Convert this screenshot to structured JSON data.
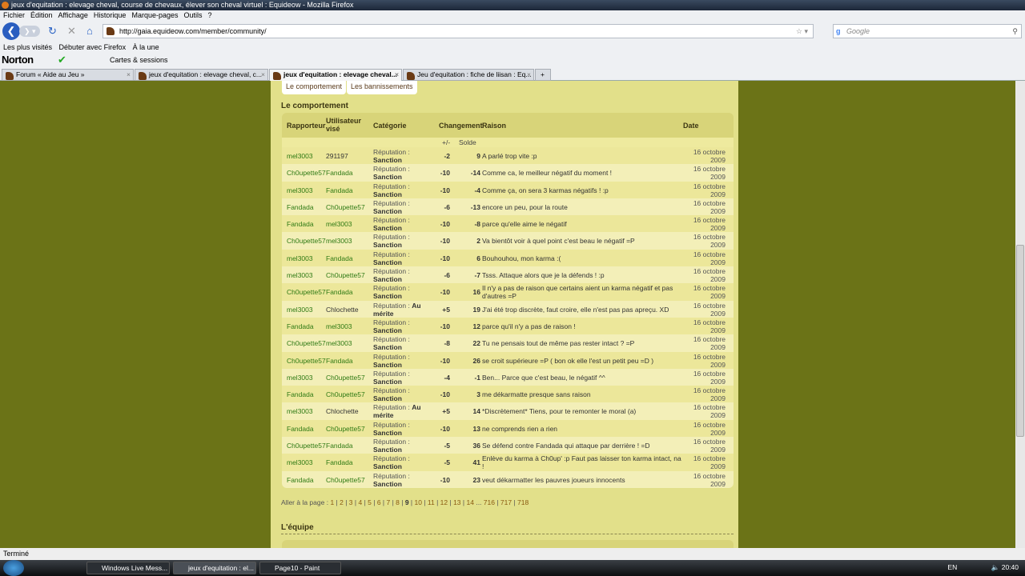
{
  "window": {
    "title": "jeux d'equitation : elevage cheval, course de chevaux, élever son cheval virtuel : Equideow - Mozilla Firefox"
  },
  "menu": [
    "Fichier",
    "Édition",
    "Affichage",
    "Historique",
    "Marque-pages",
    "Outils",
    "?"
  ],
  "url": "http://gaia.equideow.com/member/community/",
  "search_placeholder": "Google",
  "bookmarks": [
    "Les plus visités",
    "Débuter avec Firefox",
    "À la une"
  ],
  "norton": {
    "brand": "Norton",
    "cards": "Cartes & sessions"
  },
  "tabs": [
    "Forum « Aide au Jeu »",
    "jeux d'equitation : elevage cheval, c...",
    "jeux d'equitation : elevage cheval...",
    "Jeu d'equitation : fiche de liisan : Eq..."
  ],
  "subtabs": [
    "Le comportement",
    "Les bannissements"
  ],
  "section_title": "Le comportement",
  "headers": {
    "rep": "Rapporteur",
    "tgt": "Utilisateur visé",
    "cat": "Catégorie",
    "chg": "Changement",
    "rea": "Raison",
    "date": "Date",
    "pm": "+/-",
    "sol": "Solde"
  },
  "cat_prefix": "Réputation :",
  "rows": [
    {
      "rep": "mel3003",
      "tgt": "291197",
      "tl": false,
      "cat": "Sanction",
      "pm": "-2",
      "sol": "9",
      "rea": "A parlé trop vite :p",
      "date": "16 octobre 2009"
    },
    {
      "rep": "Ch0upette57",
      "tgt": "Fandada",
      "tl": true,
      "cat": "Sanction",
      "pm": "-10",
      "sol": "-14",
      "rea": "Comme ca, le meilleur négatif du moment !",
      "date": "16 octobre 2009"
    },
    {
      "rep": "mel3003",
      "tgt": "Fandada",
      "tl": true,
      "cat": "Sanction",
      "pm": "-10",
      "sol": "-4",
      "rea": "Comme ça, on sera 3 karmas négatifs ! :p",
      "date": "16 octobre 2009"
    },
    {
      "rep": "Fandada",
      "tgt": "Ch0upette57",
      "tl": true,
      "cat": "Sanction",
      "pm": "-6",
      "sol": "-13",
      "rea": "encore un peu, pour la route",
      "date": "16 octobre 2009"
    },
    {
      "rep": "Fandada",
      "tgt": "mel3003",
      "tl": true,
      "cat": "Sanction",
      "pm": "-10",
      "sol": "-8",
      "rea": "parce qu'elle aime le négatif",
      "date": "16 octobre 2009"
    },
    {
      "rep": "Ch0upette57",
      "tgt": "mel3003",
      "tl": true,
      "cat": "Sanction",
      "pm": "-10",
      "sol": "2",
      "rea": "Va bientôt voir à quel point c'est beau le négatif =P",
      "date": "16 octobre 2009"
    },
    {
      "rep": "mel3003",
      "tgt": "Fandada",
      "tl": true,
      "cat": "Sanction",
      "pm": "-10",
      "sol": "6",
      "rea": "Bouhouhou, mon karma :(",
      "date": "16 octobre 2009"
    },
    {
      "rep": "mel3003",
      "tgt": "Ch0upette57",
      "tl": true,
      "cat": "Sanction",
      "pm": "-6",
      "sol": "-7",
      "rea": "Tsss. Attaque alors que je la défends ! :p",
      "date": "16 octobre 2009"
    },
    {
      "rep": "Ch0upette57",
      "tgt": "Fandada",
      "tl": true,
      "cat": "Sanction",
      "pm": "-10",
      "sol": "16",
      "rea": "Il n'y a pas de raison que certains aient un karma négatif et pas d'autres =P",
      "date": "16 octobre 2009"
    },
    {
      "rep": "mel3003",
      "tgt": "Chlochette",
      "tl": false,
      "cat": "Au mérite",
      "pm": "+5",
      "sol": "19",
      "rea": "J'ai été trop discrète, faut croire, elle n'est pas pas apreçu. XD",
      "date": "16 octobre 2009"
    },
    {
      "rep": "Fandada",
      "tgt": "mel3003",
      "tl": true,
      "cat": "Sanction",
      "pm": "-10",
      "sol": "12",
      "rea": "parce qu'il n'y a pas de raison !",
      "date": "16 octobre 2009"
    },
    {
      "rep": "Ch0upette57",
      "tgt": "mel3003",
      "tl": true,
      "cat": "Sanction",
      "pm": "-8",
      "sol": "22",
      "rea": "Tu ne pensais tout de même pas rester intact ? =P",
      "date": "16 octobre 2009"
    },
    {
      "rep": "Ch0upette57",
      "tgt": "Fandada",
      "tl": true,
      "cat": "Sanction",
      "pm": "-10",
      "sol": "26",
      "rea": "se croit supérieure =P ( bon ok elle l'est un petit peu =D )",
      "date": "16 octobre 2009"
    },
    {
      "rep": "mel3003",
      "tgt": "Ch0upette57",
      "tl": true,
      "cat": "Sanction",
      "pm": "-4",
      "sol": "-1",
      "rea": "Ben... Parce que c'est beau, le négatif ^^",
      "date": "16 octobre 2009"
    },
    {
      "rep": "Fandada",
      "tgt": "Ch0upette57",
      "tl": true,
      "cat": "Sanction",
      "pm": "-10",
      "sol": "3",
      "rea": "me dékarmatte presque sans raison",
      "date": "16 octobre 2009"
    },
    {
      "rep": "mel3003",
      "tgt": "Chlochette",
      "tl": false,
      "cat": "Au mérite",
      "pm": "+5",
      "sol": "14",
      "rea": "*Discrètement* Tiens, pour te remonter le moral (a)",
      "date": "16 octobre 2009"
    },
    {
      "rep": "Fandada",
      "tgt": "Ch0upette57",
      "tl": true,
      "cat": "Sanction",
      "pm": "-10",
      "sol": "13",
      "rea": "ne comprends rien a rien",
      "date": "16 octobre 2009"
    },
    {
      "rep": "Ch0upette57",
      "tgt": "Fandada",
      "tl": true,
      "cat": "Sanction",
      "pm": "-5",
      "sol": "36",
      "rea": "Se défend contre Fandada qui attaque par derrière ! =D",
      "date": "16 octobre 2009"
    },
    {
      "rep": "mel3003",
      "tgt": "Fandada",
      "tl": true,
      "cat": "Sanction",
      "pm": "-5",
      "sol": "41",
      "rea": "Enlève du karma à Ch0up' :p Faut pas laisser ton karma intact, na !",
      "date": "16 octobre 2009"
    },
    {
      "rep": "Fandada",
      "tgt": "Ch0upette57",
      "tl": true,
      "cat": "Sanction",
      "pm": "-10",
      "sol": "23",
      "rea": "veut dékarmatter les pauvres joueurs innocents",
      "date": "16 octobre 2009"
    }
  ],
  "pager": {
    "label": "Aller à la page :",
    "pages": [
      "1",
      "2",
      "3",
      "4",
      "5",
      "6",
      "7",
      "8",
      "9",
      "10",
      "11",
      "12",
      "13",
      "14",
      "...",
      "716",
      "717",
      "718"
    ],
    "current": "9"
  },
  "team_title": "L'équipe",
  "status": "Terminé",
  "taskbar": {
    "items": [
      "Windows Live Mess...",
      "jeux d'equitation : el...",
      "Page10 - Paint"
    ],
    "lang": "EN",
    "clock": "20:40"
  }
}
